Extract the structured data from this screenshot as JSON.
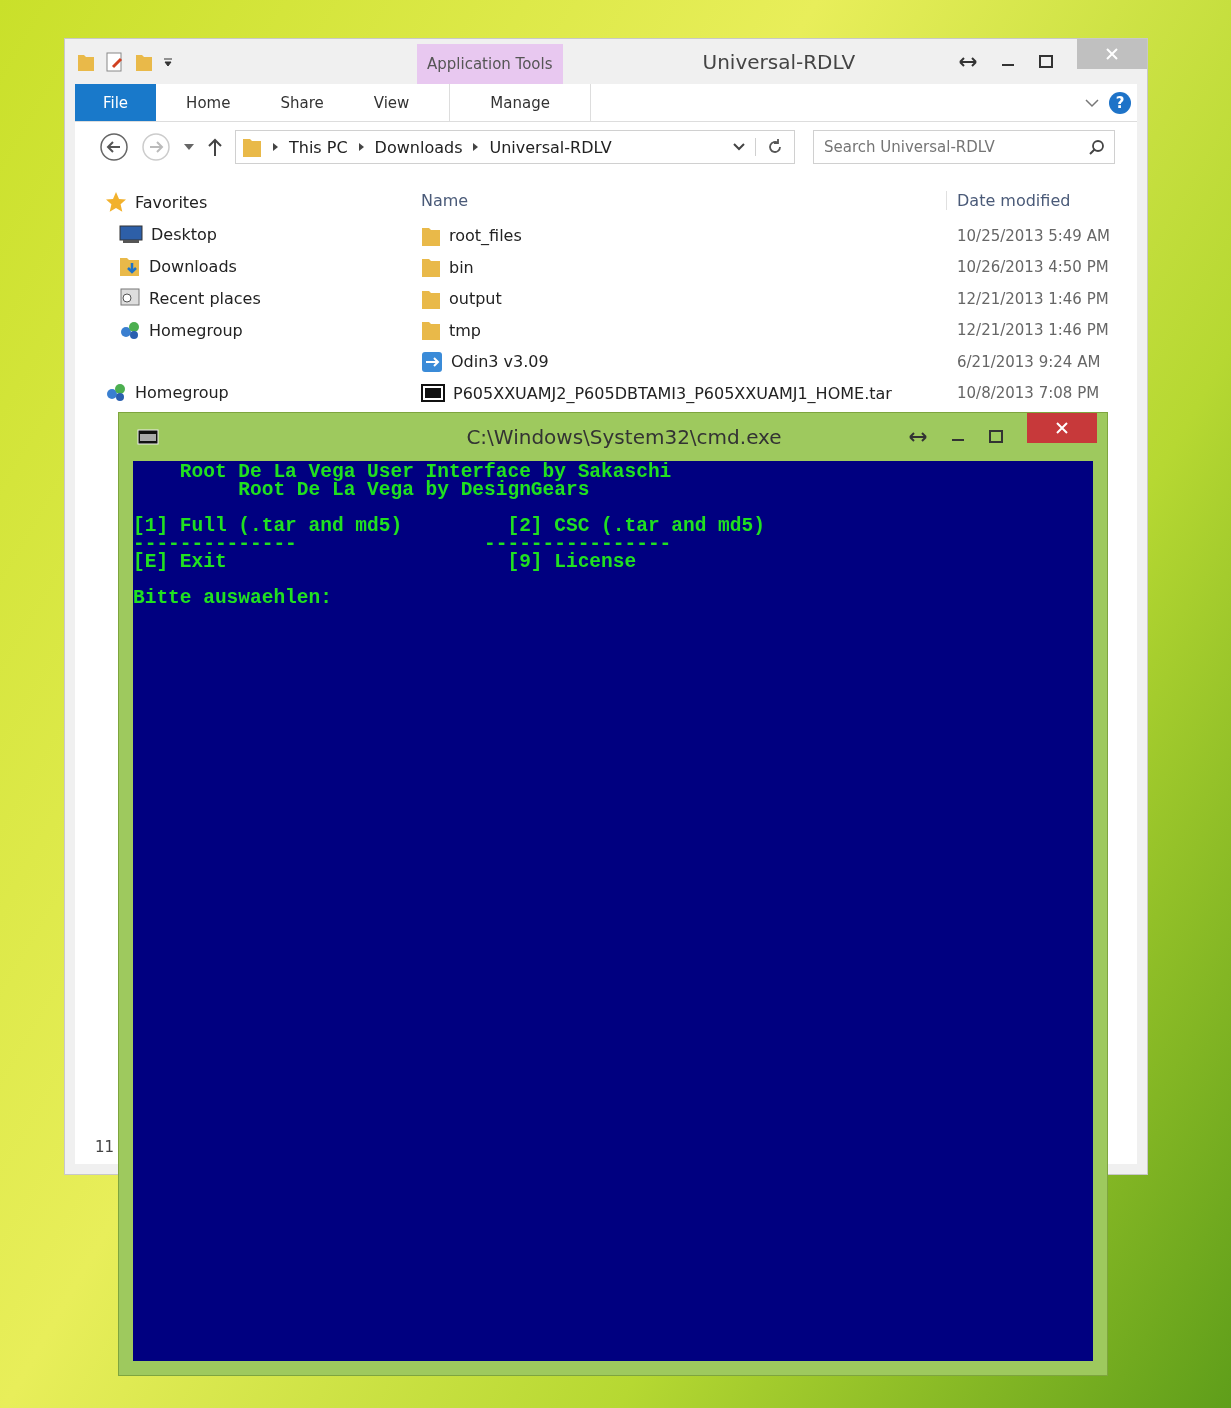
{
  "explorer": {
    "title": "Universal-RDLV",
    "context_tab": "Application Tools",
    "ribbon_tabs": [
      {
        "label": "File",
        "kind": "file",
        "selected": false
      },
      {
        "label": "Home",
        "kind": "tab",
        "selected": false
      },
      {
        "label": "Share",
        "kind": "tab",
        "selected": false
      },
      {
        "label": "View",
        "kind": "tab",
        "selected": false
      },
      {
        "label": "Manage",
        "kind": "context",
        "selected": false
      }
    ],
    "breadcrumb": [
      "This PC",
      "Downloads",
      "Universal-RDLV"
    ],
    "search": {
      "placeholder": "Search Universal-RDLV"
    },
    "help": "?",
    "nav": [
      {
        "label": "Favorites",
        "kind": "star",
        "children": [
          {
            "label": "Desktop",
            "kind": "desktop"
          },
          {
            "label": "Downloads",
            "kind": "downloads"
          },
          {
            "label": "Recent places",
            "kind": "recent"
          },
          {
            "label": "Homegroup",
            "kind": "homegroup"
          }
        ]
      },
      {
        "label": "Homegroup",
        "kind": "homegroup"
      }
    ],
    "columns": [
      "Name",
      "Date modified"
    ],
    "files": [
      {
        "name": "root_files",
        "date": "10/25/2013 5:49 AM",
        "kind": "folder"
      },
      {
        "name": "bin",
        "date": "10/26/2013 4:50 PM",
        "kind": "folder"
      },
      {
        "name": "output",
        "date": "12/21/2013 1:46 PM",
        "kind": "folder"
      },
      {
        "name": "tmp",
        "date": "12/21/2013 1:46 PM",
        "kind": "folder"
      },
      {
        "name": "Odin3 v3.09",
        "date": "6/21/2013 9:24 AM",
        "kind": "app"
      },
      {
        "name": "P605XXUAMJ2_P605DBTAMI3_P605XXUAMJ1_HOME.tar",
        "date": "10/8/2013 7:08 PM",
        "kind": "archive"
      }
    ],
    "status": "11"
  },
  "console": {
    "title": "C:\\Windows\\System32\\cmd.exe",
    "blocks": [
      [
        "    Root De La Vega User Interface by Sakaschi",
        "         Root De La Vega by DesignGears"
      ],
      [
        "[1] Full (.tar and md5)         [2] CSC (.tar and md5)",
        "--------------                ----------------",
        "[E] Exit                        [9] License"
      ],
      [
        "Bitte auswaehlen:"
      ]
    ]
  }
}
